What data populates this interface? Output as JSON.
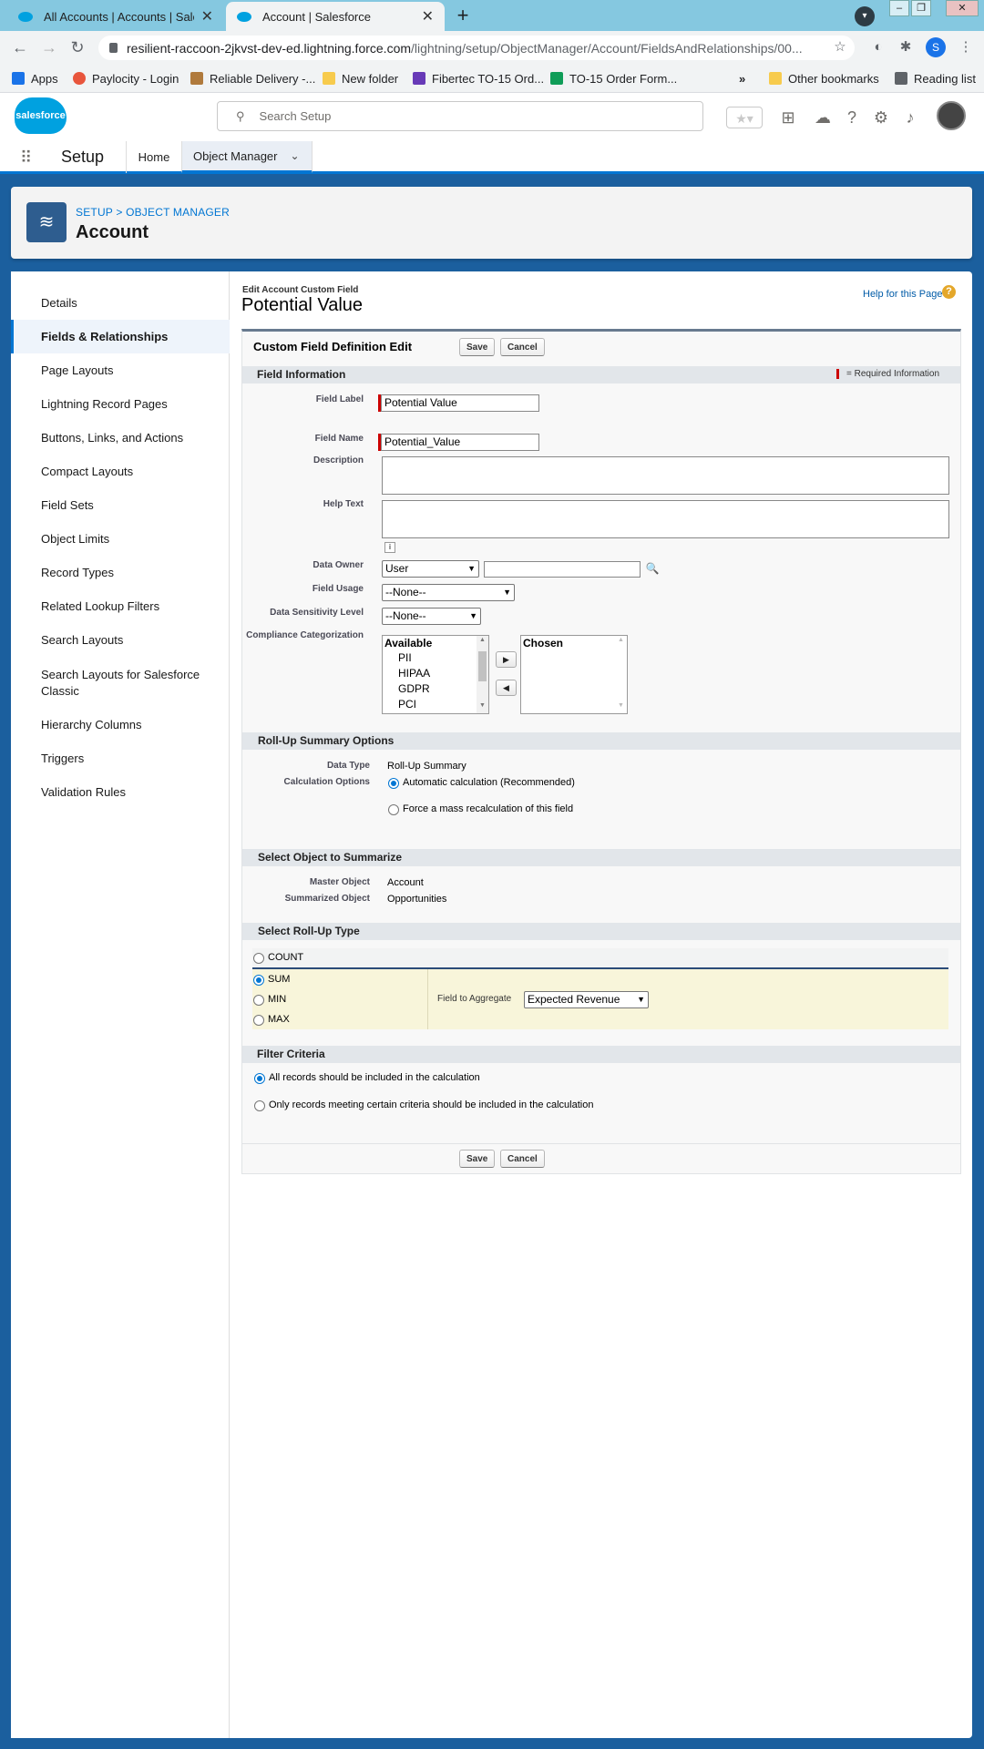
{
  "browser": {
    "tabs": [
      {
        "title": "All Accounts | Accounts | Salesforce"
      },
      {
        "title": "Account | Salesforce"
      }
    ],
    "new_tab": "+",
    "profile_initial": "S",
    "url_host": "resilient-raccoon-2jkvst-dev-ed.lightning.force.com",
    "url_path": "/lightning/setup/ObjectManager/Account/FieldsAndRelationships/00...",
    "bookmarks": [
      {
        "label": "Apps",
        "color": "#1a73e8"
      },
      {
        "label": "Paylocity - Login",
        "color": "#e8553c"
      },
      {
        "label": "Reliable Delivery -...",
        "color": "#b07a3c"
      },
      {
        "label": "New folder",
        "color": "#f7cb4d"
      },
      {
        "label": "Fibertec TO-15 Ord...",
        "color": "#673ab7"
      },
      {
        "label": "TO-15 Order Form...",
        "color": "#0f9d58"
      },
      {
        "label": "Other bookmarks",
        "color": "#f7cb4d"
      },
      {
        "label": "Reading list",
        "color": "#5f6368"
      }
    ],
    "more_bookmarks": "»"
  },
  "sf": {
    "logo_text": "salesforce",
    "search_placeholder": "Search Setup",
    "app_name": "Setup",
    "nav_home": "Home",
    "nav_object_manager": "Object Manager",
    "breadcrumb": "SETUP > OBJECT MANAGER",
    "object_title": "Account",
    "brand_color": "#0176d3"
  },
  "sidebar": {
    "items": [
      {
        "label": "Details",
        "active": false
      },
      {
        "label": "Fields & Relationships",
        "active": true
      },
      {
        "label": "Page Layouts",
        "active": false
      },
      {
        "label": "Lightning Record Pages",
        "active": false
      },
      {
        "label": "Buttons, Links, and Actions",
        "active": false
      },
      {
        "label": "Compact Layouts",
        "active": false
      },
      {
        "label": "Field Sets",
        "active": false
      },
      {
        "label": "Object Limits",
        "active": false
      },
      {
        "label": "Record Types",
        "active": false
      },
      {
        "label": "Related Lookup Filters",
        "active": false
      },
      {
        "label": "Search Layouts",
        "active": false
      },
      {
        "label": "Search Layouts for Salesforce Classic",
        "active": false
      },
      {
        "label": "Hierarchy Columns",
        "active": false
      },
      {
        "label": "Triggers",
        "active": false
      },
      {
        "label": "Validation Rules",
        "active": false
      }
    ]
  },
  "edit": {
    "subtitle": "Edit Account Custom Field",
    "title": "Potential Value",
    "help_link": "Help for this Page",
    "help_icon": "?",
    "panel_title": "Custom Field Definition Edit",
    "save": "Save",
    "cancel": "Cancel"
  },
  "field_info": {
    "header": "Field Information",
    "required_note": "= Required Information",
    "field_label_lbl": "Field Label",
    "field_label_val": "Potential Value",
    "field_name_lbl": "Field Name",
    "field_name_val": "Potential_Value",
    "description_lbl": "Description",
    "help_text_lbl": "Help Text",
    "info_icon": "i",
    "data_owner_lbl": "Data Owner",
    "data_owner_val": "User",
    "field_usage_lbl": "Field Usage",
    "field_usage_val": "--None--",
    "sensitivity_lbl": "Data Sensitivity Level",
    "sensitivity_val": "--None--",
    "compliance_lbl": "Compliance Categorization",
    "available_hdr": "Available",
    "available_opts": [
      "PII",
      "HIPAA",
      "GDPR",
      "PCI"
    ],
    "chosen_hdr": "Chosen"
  },
  "rollup_options": {
    "header": "Roll-Up Summary Options",
    "data_type_lbl": "Data Type",
    "data_type_val": "Roll-Up Summary",
    "calc_lbl": "Calculation Options",
    "calc_auto": "Automatic calculation (Recommended)",
    "calc_force": "Force a mass recalculation of this field"
  },
  "summarize": {
    "header": "Select Object to Summarize",
    "master_lbl": "Master Object",
    "master_val": "Account",
    "summarized_lbl": "Summarized Object",
    "summarized_val": "Opportunities"
  },
  "rollup_type": {
    "header": "Select Roll-Up Type",
    "count": "COUNT",
    "sum": "SUM",
    "min": "MIN",
    "max": "MAX",
    "aggregate_lbl": "Field to Aggregate",
    "aggregate_val": "Expected Revenue",
    "selected": "SUM"
  },
  "filter": {
    "header": "Filter Criteria",
    "all_records": "All records should be included in the calculation",
    "only_records": "Only records meeting certain criteria should be included in the calculation"
  }
}
